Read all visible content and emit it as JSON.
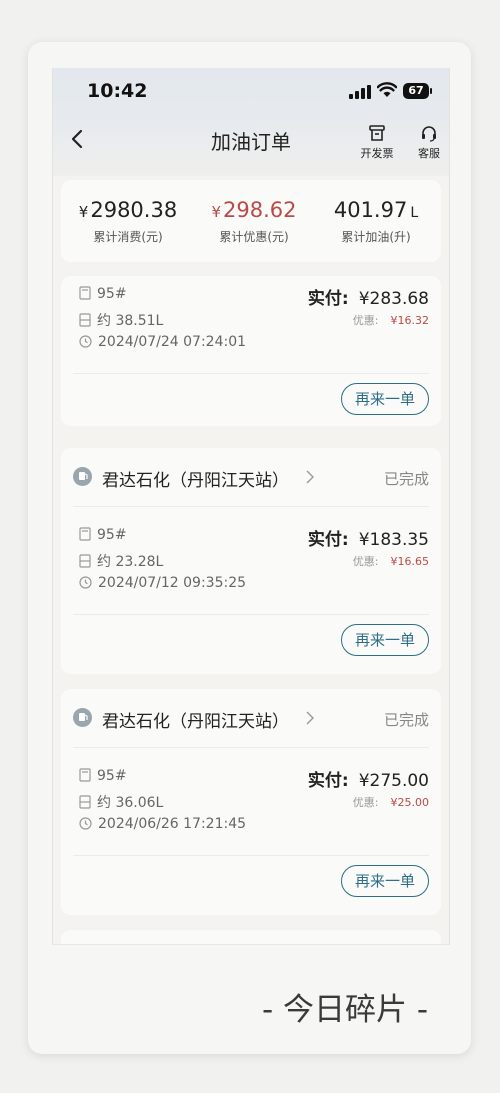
{
  "status_bar": {
    "time": "10:42",
    "battery": "67"
  },
  "nav": {
    "title": "加油订单",
    "invoice_label": "开发票",
    "service_label": "客服"
  },
  "summary": {
    "spend": {
      "currency": "¥",
      "value": "2980.38",
      "label": "累计消费(元)"
    },
    "savings": {
      "currency": "¥",
      "value": "298.62",
      "label": "累计优惠(元)"
    },
    "fuel": {
      "value": "401.97",
      "unit": "L",
      "label": "累计加油(升)"
    }
  },
  "orders": [
    {
      "fuel_grade": "95#",
      "volume": "约 38.51L",
      "datetime": "2024/07/24 07:24:01",
      "paid_label": "实付:",
      "paid_amount": "¥283.68",
      "discount_label": "优惠:",
      "discount_amount": "¥16.32",
      "reorder_label": "再来一单"
    },
    {
      "station": "君达石化（丹阳江天站）",
      "status": "已完成",
      "fuel_grade": "95#",
      "volume": "约 23.28L",
      "datetime": "2024/07/12 09:35:25",
      "paid_label": "实付:",
      "paid_amount": "¥183.35",
      "discount_label": "优惠:",
      "discount_amount": "¥16.65",
      "reorder_label": "再来一单"
    },
    {
      "station": "君达石化（丹阳江天站）",
      "status": "已完成",
      "fuel_grade": "95#",
      "volume": "约 36.06L",
      "datetime": "2024/06/26 17:21:45",
      "paid_label": "实付:",
      "paid_amount": "¥275.00",
      "discount_label": "优惠:",
      "discount_amount": "¥25.00",
      "reorder_label": "再来一单"
    }
  ],
  "watermark": "- 今日碎片 -",
  "icons": [
    "back-icon",
    "invoice-icon",
    "headset-icon",
    "fuel-pump-icon",
    "chevron-right-icon",
    "document-icon",
    "fuel-gauge-icon",
    "clock-icon",
    "cellular-signal-icon",
    "wifi-icon",
    "battery-icon"
  ],
  "colors": {
    "accent": "#2d6f86",
    "discount": "#b94a48"
  }
}
